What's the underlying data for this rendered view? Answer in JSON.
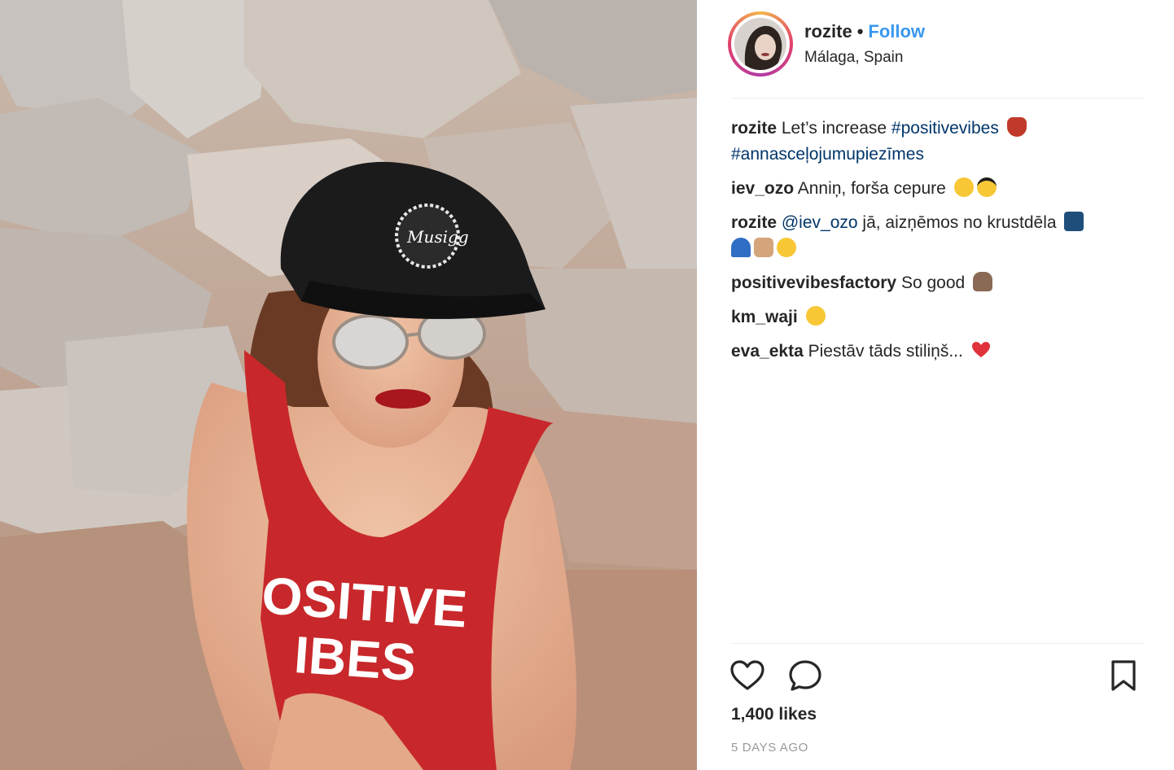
{
  "post": {
    "photo_alt_icon": "post-photo",
    "header": {
      "username": "rozite",
      "separator": "•",
      "follow_label": "Follow",
      "location": "Málaga, Spain"
    },
    "caption": {
      "username": "rozite",
      "text": "Let’s increase",
      "hashtag1": "#positivevibes",
      "hashtag2": "#annasceļojumupiezīmes"
    },
    "comments": [
      {
        "username": "iev_ozo",
        "text": "Anniņ, forša cepure"
      },
      {
        "username": "rozite",
        "mention": "@iev_ozo",
        "text": "jā, aizņēmos no krustdēla"
      },
      {
        "username": "positivevibesfactory",
        "text": "So good"
      },
      {
        "username": "km_waji",
        "text": ""
      },
      {
        "username": "eva_ekta",
        "text": "Piestāv tāds stiliņš..."
      }
    ],
    "likes": "1,400 likes",
    "time_ago": "5 DAYS AGO",
    "colors": {
      "follow": "#3897f0",
      "hashtag": "#003569",
      "text": "#262626",
      "muted": "#999999"
    },
    "icons": [
      "heart-icon",
      "comment-icon",
      "bookmark-icon"
    ]
  }
}
